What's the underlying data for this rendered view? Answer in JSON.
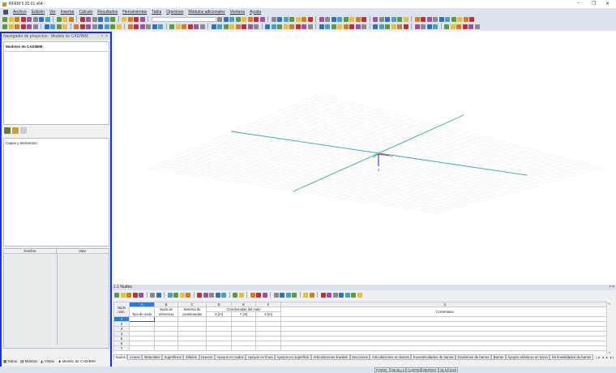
{
  "window": {
    "title": "RFEM 5.20.01 x64 -",
    "min": "–",
    "restore": "❐",
    "close": "✕"
  },
  "menu": [
    "Archivo",
    "Edición",
    "Ver",
    "Insertar",
    "Cálculo",
    "Resultados",
    "Herramientas",
    "Tabla",
    "Opciones",
    "Módulos adicionales",
    "Ventana",
    "Ayuda"
  ],
  "navigator": {
    "title": "Navegador de proyectos - Modelo de CAD/BIM",
    "pin": "ᵖ",
    "close": "×",
    "models_label": "Modelos de CAD/BIM:",
    "layers_label": "Capas y elementos:",
    "prop_headers": [
      "Nombre",
      "Valor"
    ],
    "tabs": [
      "Datos",
      "Mostrar",
      "Vistas",
      "Modelo de CAD/BIM"
    ]
  },
  "viewport": {
    "axes": {
      "x": "X",
      "y": "Y",
      "z": "Z"
    }
  },
  "table": {
    "title": "1.1 Nudos",
    "col_letters": [
      "A",
      "B",
      "C",
      "D",
      "E",
      "F",
      "G"
    ],
    "header_row1": {
      "node": "Nudo",
      "ref": "Nudo de",
      "system": "Sistema de",
      "coords": "Coordenadas del nudo"
    },
    "header_row2": {
      "node": "núm.",
      "type": "Tipo de nudo",
      "ref": "referencia",
      "system": "coordenadas",
      "x": "X [m]",
      "y": "Y [m]",
      "z": "Z [m]",
      "comment": "Comentario"
    },
    "rows": [
      "1",
      "2",
      "3",
      "4",
      "5",
      "6",
      "7"
    ],
    "tabs": [
      "Nudos",
      "Líneas",
      "Materiales",
      "Superficies",
      "Sólidos",
      "Huecos",
      "Apoyos en nudos",
      "Apoyos en línea",
      "Apoyos en superficie",
      "Articulaciones lineales",
      "Secciones",
      "Articulaciones en barras",
      "Excentricidades de barras",
      "Divisiones de barras",
      "Barras",
      "Apoyos elásticos en barra",
      "No linealidades de barras"
    ]
  },
  "status": [
    "FORZC",
    "REJILLA",
    "CARTES",
    "REFENT",
    "GLN",
    "DXF"
  ],
  "colors": {
    "accent": "#1a2bff",
    "grid_line": "#3aa89a",
    "axis_x": "#e02020",
    "axis_y": "#20b020",
    "axis_z": "#2020d0"
  }
}
